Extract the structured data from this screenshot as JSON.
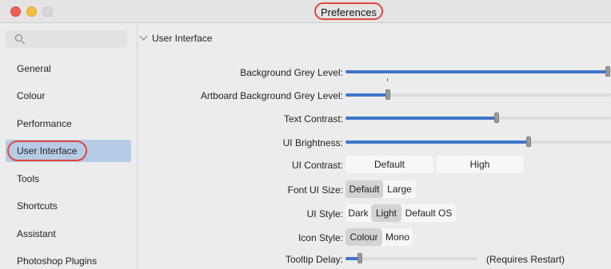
{
  "window": {
    "title": "Preferences"
  },
  "sidebar": {
    "search_placeholder": "",
    "items": [
      {
        "label": "General"
      },
      {
        "label": "Colour"
      },
      {
        "label": "Performance"
      },
      {
        "label": "User Interface",
        "selected": true
      },
      {
        "label": "Tools"
      },
      {
        "label": "Shortcuts"
      },
      {
        "label": "Assistant"
      },
      {
        "label": "Photoshop Plugins"
      }
    ]
  },
  "main": {
    "section_title": "User Interface",
    "background_grey_level": {
      "label": "Background Grey Level:",
      "value": 0.99
    },
    "artboard_background_grey_level": {
      "label": "Artboard Background Grey Level:",
      "value": 0.16
    },
    "text_contrast": {
      "label": "Text Contrast:",
      "value": 0.57
    },
    "ui_brightness": {
      "label": "UI Brightness:",
      "value": 0.69
    },
    "ui_contrast": {
      "label": "UI Contrast:",
      "options": [
        "Default",
        "High"
      ]
    },
    "font_ui_size": {
      "label": "Font UI Size:",
      "options": [
        "Default",
        "Large"
      ],
      "selected": "Default"
    },
    "ui_style": {
      "label": "UI Style:",
      "options": [
        "Dark",
        "Light",
        "Default OS"
      ],
      "selected": "Light"
    },
    "icon_style": {
      "label": "Icon Style:",
      "options": [
        "Colour",
        "Mono"
      ],
      "selected": "Colour"
    },
    "tooltip_delay": {
      "label": "Tooltip Delay:",
      "value": 0.11,
      "note": "(Requires Restart)"
    }
  },
  "colors": {
    "accent": "#3d76c9",
    "selection": "#b6cce6",
    "highlight_ring": "#e0483a"
  }
}
